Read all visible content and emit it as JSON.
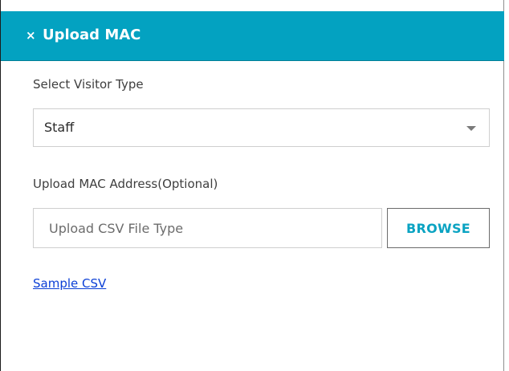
{
  "header": {
    "close_glyph": "×",
    "title": "Upload MAC",
    "background_color": "#03a2c1"
  },
  "visitor_type": {
    "label": "Select Visitor Type",
    "selected_value": "Staff",
    "caret_icon": "chevron-down-icon"
  },
  "upload": {
    "label": "Upload MAC Address(Optional)",
    "placeholder": "Upload CSV File Type",
    "browse_label": "BROWSE"
  },
  "sample_link": {
    "label": "Sample CSV"
  }
}
